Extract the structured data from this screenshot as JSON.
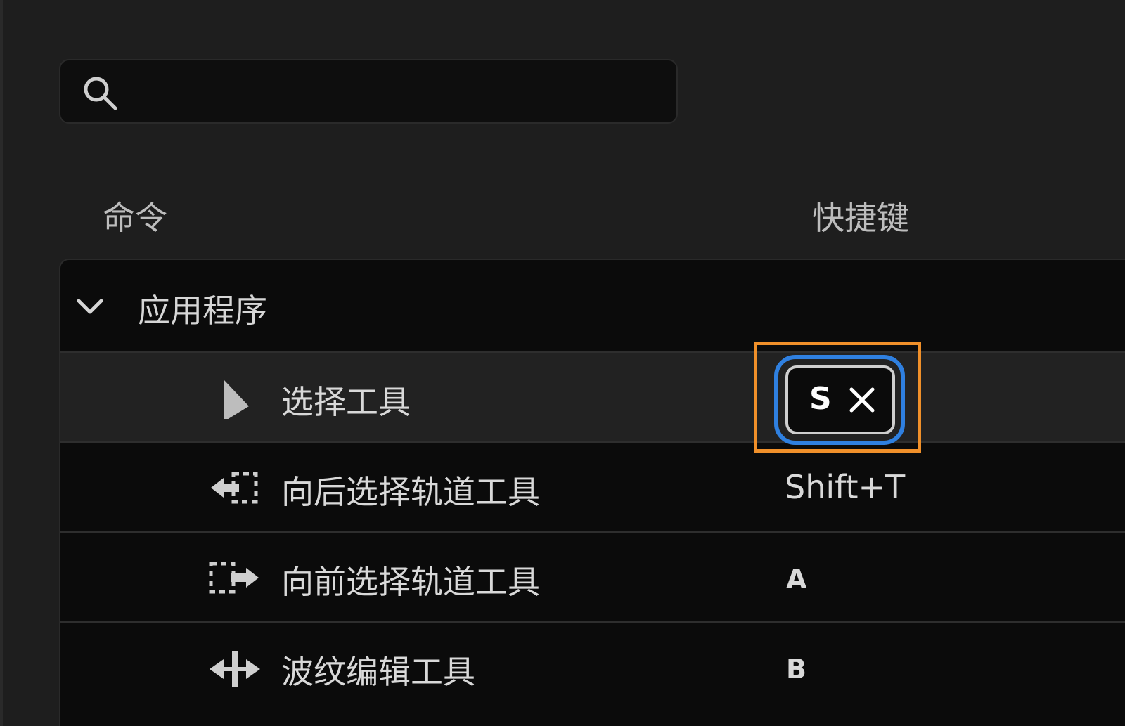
{
  "search": {
    "placeholder": "",
    "value": ""
  },
  "columns": {
    "command": "命令",
    "shortcut": "快捷键"
  },
  "group": {
    "label": "应用程序",
    "expanded": true
  },
  "rows": [
    {
      "label": "选择工具",
      "icon": "selection-arrow-icon",
      "shortcut": "S",
      "selected": true,
      "editing": true
    },
    {
      "label": "向后选择轨道工具",
      "icon": "track-select-backward-icon",
      "shortcut": "Shift+T"
    },
    {
      "label": "向前选择轨道工具",
      "icon": "track-select-forward-icon",
      "shortcut": "A"
    },
    {
      "label": "波纹编辑工具",
      "icon": "ripple-edit-icon",
      "shortcut": "B"
    }
  ],
  "colors": {
    "highlight": "#f0902a",
    "focus": "#2f80e0",
    "background": "#1e1e1e",
    "panel": "#0b0b0b"
  }
}
